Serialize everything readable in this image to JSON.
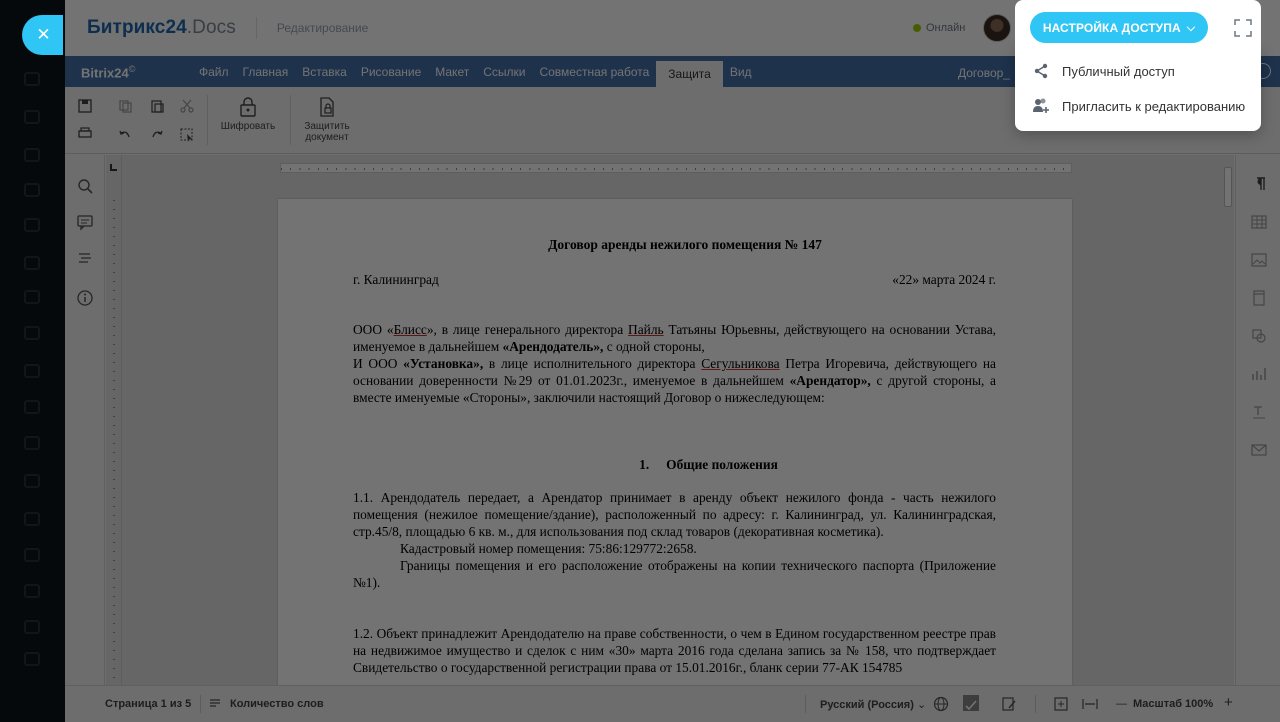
{
  "header": {
    "brand_main": "Битрикс24",
    "brand_sub": ".Docs",
    "mode": "Редактирование",
    "online_status": "Онлайн",
    "access_button": "НАСТРОЙКА ДОСТУПА"
  },
  "access_menu": {
    "items": [
      {
        "label": "Публичный доступ",
        "icon": "share-icon"
      },
      {
        "label": "Пригласить к редактированию",
        "icon": "add-user-icon"
      }
    ]
  },
  "menubar": {
    "logo": "Bitrix24",
    "logo_mark": "©",
    "tabs": [
      "Файл",
      "Главная",
      "Вставка",
      "Рисование",
      "Макет",
      "Ссылки",
      "Совместная работа",
      "Защита",
      "Вид"
    ],
    "active_tab": "Защита",
    "document_name": "Договор_"
  },
  "toolbar": {
    "encrypt_label": "Шифровать",
    "protect_label_1": "Защитить",
    "protect_label_2": "документ"
  },
  "document": {
    "title": "Договор аренды нежилого помещения № 147",
    "city": "г. Калининград",
    "date": "«22» марта 2024 г.",
    "p1": {
      "a": "ООО «",
      "bliss": "Блисс",
      "b": "», в лице генерального директора ",
      "paily": "Пайль",
      "c": " Татьяны Юрьевны, действующего на основании Устава, именуемое в дальнейшем ",
      "landlord": "«Арендодатель»,",
      "d": " с одной стороны,"
    },
    "p1b": {
      "a": "И ООО ",
      "ustanovka": "«Установка»,",
      "b": " в лице исполнительного директора ",
      "segul": "Сегульникова",
      "c": " Петра Игоревича, действующего на основании доверенности №29 от 01.01.2023г., именуемое в дальнейшем ",
      "tenant": "«Арендатор»,",
      "d": " с другой стороны, а вместе именуемые «Стороны», заключили настоящий Договор о нижеследующем:"
    },
    "section_num": "1.",
    "section_title": "Общие положения",
    "p2": "1.1. Арендодатель передает, а Арендатор принимает в аренду объект нежилого фонда - часть нежилого помещения (нежилое помещение/здание), расположенный по адресу: г. Калининград, ул. Калининградская, стр.45/8, площадью 6 кв. м., для использования под склад товаров (декоративная косметика).",
    "p2b": "Кадастровый номер помещения: 75:86:129772:2658.",
    "p2c": "Границы помещения и его расположение отображены на копии технического паспорта (Приложение №1).",
    "p3": "1.2. Объект принадлежит Арендодателю на праве собственности, о чем в Едином государственном реестре прав на недвижимое имущество и сделок с ним «30» марта 2016 года сделана запись за № 158, что подтверждает Свидетельство о государственной регистрации права от 15.01.2016г., бланк серии 77-АК 154785"
  },
  "statusbar": {
    "page": "Страница 1 из 5",
    "word_count": "Количество слов",
    "language": "Русский (Россия)",
    "zoom": "Масштаб 100%",
    "zoom_minus": "—",
    "zoom_plus": "+"
  },
  "colors": {
    "accent": "#2fc6f6",
    "menubar": "#446fa8",
    "brand_dark": "#2066b0",
    "online": "#9dcf00"
  }
}
